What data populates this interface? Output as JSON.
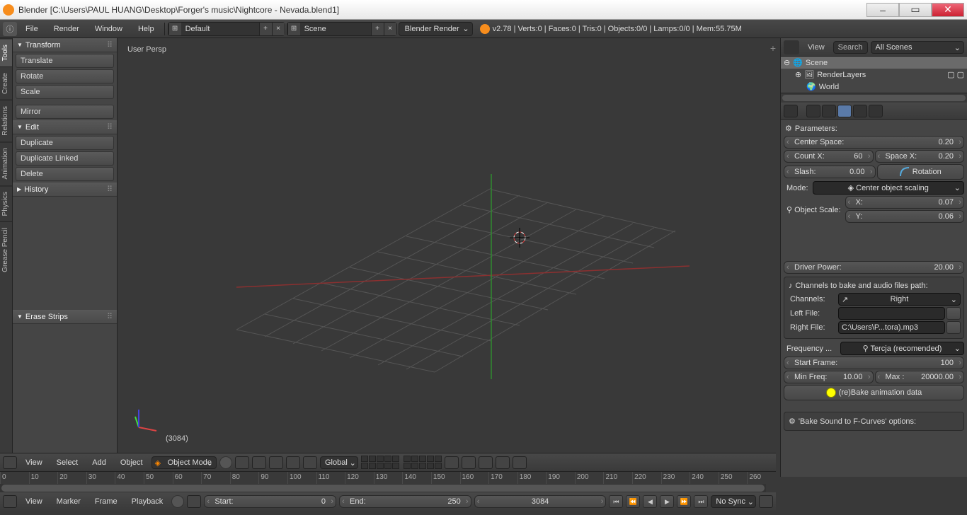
{
  "window": {
    "title": "Blender [C:\\Users\\PAUL HUANG\\Desktop\\Forger's music\\Nightcore - Nevada.blend1]"
  },
  "menubar": {
    "items": [
      "File",
      "Render",
      "Window",
      "Help"
    ],
    "layout": "Default",
    "scene": "Scene",
    "engine": "Blender Render",
    "stats": "v2.78 | Verts:0 | Faces:0 | Tris:0 | Objects:0/0 | Lamps:0/0 | Mem:55.75M"
  },
  "vtabs": [
    "Tools",
    "Create",
    "Relations",
    "Animation",
    "Physics",
    "Grease Pencil"
  ],
  "leftpanel": {
    "transform": {
      "title": "Transform",
      "buttons": [
        "Translate",
        "Rotate",
        "Scale",
        "Mirror"
      ]
    },
    "edit": {
      "title": "Edit",
      "buttons": [
        "Duplicate",
        "Duplicate Linked",
        "Delete"
      ]
    },
    "history": {
      "title": "History"
    },
    "erase": {
      "title": "Erase Strips"
    }
  },
  "viewport": {
    "persp": "User Persp",
    "frame": "(3084)"
  },
  "outliner": {
    "view": "View",
    "search": "Search",
    "filter": "All Scenes",
    "tree": {
      "scene": "Scene",
      "renderlayers": "RenderLayers",
      "world": "World"
    }
  },
  "props": {
    "parameters": "Parameters:",
    "center_space": {
      "label": "Center Space:",
      "value": "0.20"
    },
    "count_x": {
      "label": "Count X:",
      "value": "60"
    },
    "space_x": {
      "label": "Space X:",
      "value": "0.20"
    },
    "slash": {
      "label": "Slash:",
      "value": "0.00"
    },
    "rotation": "Rotation",
    "mode": {
      "label": "Mode:",
      "value": "Center object scaling"
    },
    "object_scale": "Object Scale:",
    "scale_x": {
      "label": "X:",
      "value": "0.07"
    },
    "scale_y": {
      "label": "Y:",
      "value": "0.06"
    },
    "driver_power": {
      "label": "Driver Power:",
      "value": "20.00"
    },
    "channels_panel": "Channels to bake and audio files path:",
    "channels": {
      "label": "Channels:",
      "value": "Right"
    },
    "left_file": {
      "label": "Left File:",
      "value": ""
    },
    "right_file": {
      "label": "Right File:",
      "value": "C:\\Users\\P...tora).mp3"
    },
    "frequency": {
      "label": "Frequency ...",
      "value": "Tercja (recomended)"
    },
    "start_frame": {
      "label": "Start Frame:",
      "value": "100"
    },
    "min_freq": {
      "label": "Min Freq:",
      "value": "10.00"
    },
    "max_freq": {
      "label": "Max :",
      "value": "20000.00"
    },
    "bake": "(re)Bake animation data",
    "bake_sound": "'Bake Sound to F-Curves' options:"
  },
  "viewhdr": {
    "view": "View",
    "select": "Select",
    "add": "Add",
    "object": "Object",
    "mode": "Object Mode",
    "orient": "Global"
  },
  "timeline": {
    "ticks": [
      "0",
      "10",
      "20",
      "30",
      "40",
      "50",
      "60",
      "70",
      "80",
      "90",
      "100",
      "110",
      "120",
      "130",
      "140",
      "150",
      "160",
      "170",
      "180",
      "190",
      "200",
      "210",
      "220",
      "230",
      "240",
      "250",
      "260"
    ],
    "view": "View",
    "marker": "Marker",
    "frame": "Frame",
    "playback": "Playback",
    "start": {
      "label": "Start:",
      "value": "0"
    },
    "end": {
      "label": "End:",
      "value": "250"
    },
    "current": "3084",
    "sync": "No Sync"
  }
}
